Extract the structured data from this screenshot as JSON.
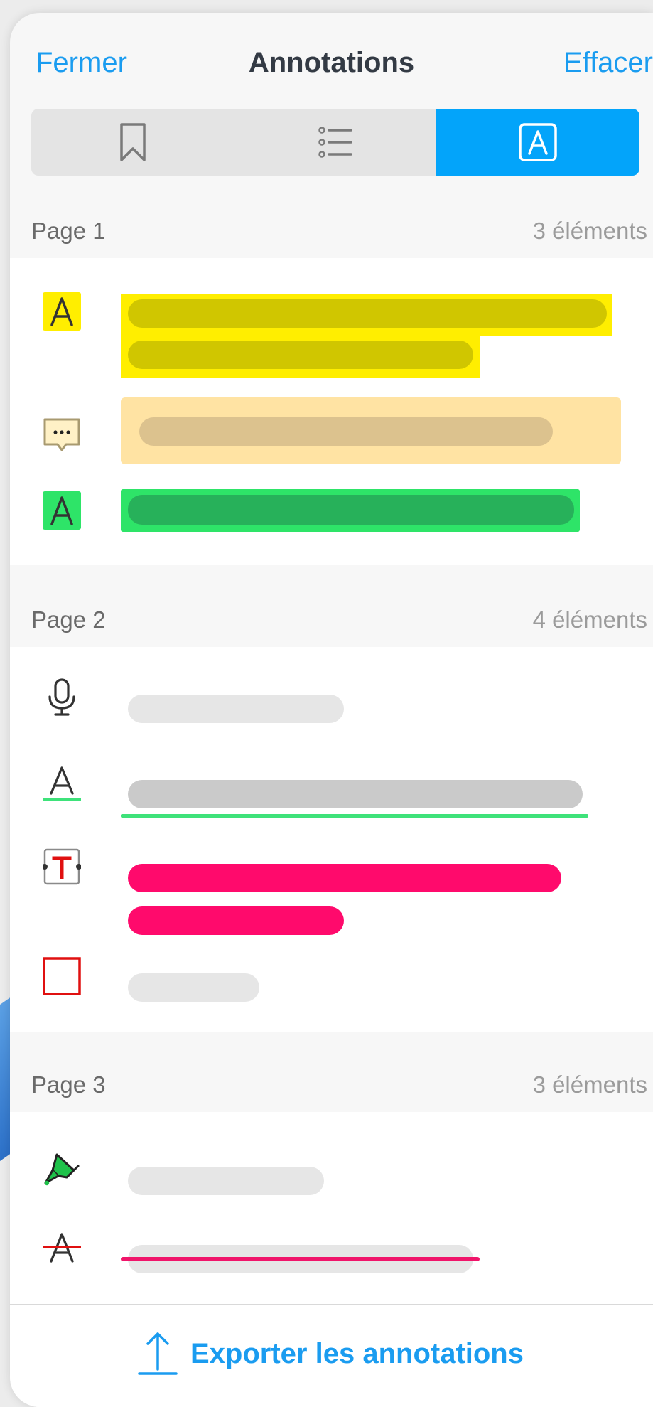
{
  "header": {
    "close_label": "Fermer",
    "title": "Annotations",
    "clear_label": "Effacer"
  },
  "tabs": {
    "bookmarks_icon": "bookmark-icon",
    "outline_icon": "list-icon",
    "annotations_icon": "annotation-icon",
    "selected": "annotations",
    "accent_color": "#03a4fa"
  },
  "sections": [
    {
      "label": "Page 1",
      "count": "3 éléments"
    },
    {
      "label": "Page 2",
      "count": "4 éléments"
    },
    {
      "label": "Page 3",
      "count": "3 éléments"
    }
  ],
  "annotation_types": {
    "page1": [
      "highlight-yellow",
      "note-comment",
      "highlight-green"
    ],
    "page2": [
      "audio-note",
      "underline-green",
      "text-box",
      "rectangle-shape"
    ],
    "page3": [
      "highlighter-pen",
      "strikethrough"
    ]
  },
  "colors": {
    "highlight_yellow": "#ffee00",
    "note_orange": "#ffe3a3",
    "highlight_green": "#2ee468",
    "underline_green": "#3ee27a",
    "textbox_pink": "#ff0a6c",
    "rectangle_red": "#e01010",
    "strike_pink": "#f0156a"
  },
  "footer": {
    "export_label": "Exporter les annotations",
    "export_icon": "share-upload-icon"
  }
}
